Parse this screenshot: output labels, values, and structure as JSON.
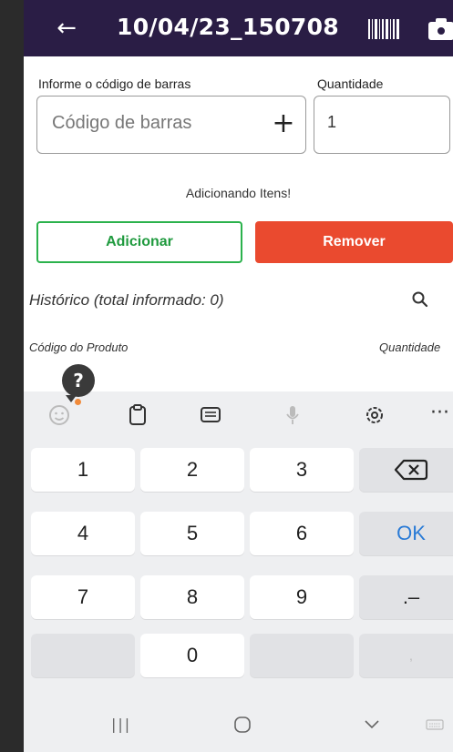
{
  "header": {
    "title": "10/04/23_150708",
    "back_icon": "arrow-left-icon",
    "barcode_icon": "barcode-icon",
    "camera_icon": "camera-icon",
    "background": "#2a1d45"
  },
  "form": {
    "barcode_label": "Informe o código de barras",
    "barcode_placeholder": "Código de barras",
    "barcode_value": "",
    "quantity_label": "Quantidade",
    "quantity_value": "1",
    "add_code_symbol": "+"
  },
  "status_message": "Adicionando Itens!",
  "actions": {
    "add_label": "Adicionar",
    "remove_label": "Remover",
    "add_color": "#2bb24c",
    "remove_color": "#ea4a2f"
  },
  "history": {
    "title": "Histórico (total informado: 0)",
    "search_icon": "search-icon",
    "columns": [
      "Código do Produto",
      "Quantidade"
    ]
  },
  "help": {
    "symbol": "?"
  },
  "keyboard": {
    "toolbar_icons": [
      "emoji-icon",
      "clipboard-icon",
      "keyboard-mode-icon",
      "microphone-icon",
      "gear-icon",
      "more-icon"
    ],
    "more_symbol": "···",
    "keys": {
      "k1": "1",
      "k2": "2",
      "k3": "3",
      "k4": "4",
      "k5": "5",
      "k6": "6",
      "k7": "7",
      "k8": "8",
      "k9": "9",
      "k0": "0",
      "ok": "OK",
      "dot_dash": ".–",
      "comma": ","
    },
    "backspace_icon": "backspace-icon"
  },
  "navbar": {
    "icons": [
      "recent-apps-icon",
      "home-icon",
      "back-down-icon",
      "keyboard-switch-icon"
    ],
    "recent_symbol": "|||"
  }
}
